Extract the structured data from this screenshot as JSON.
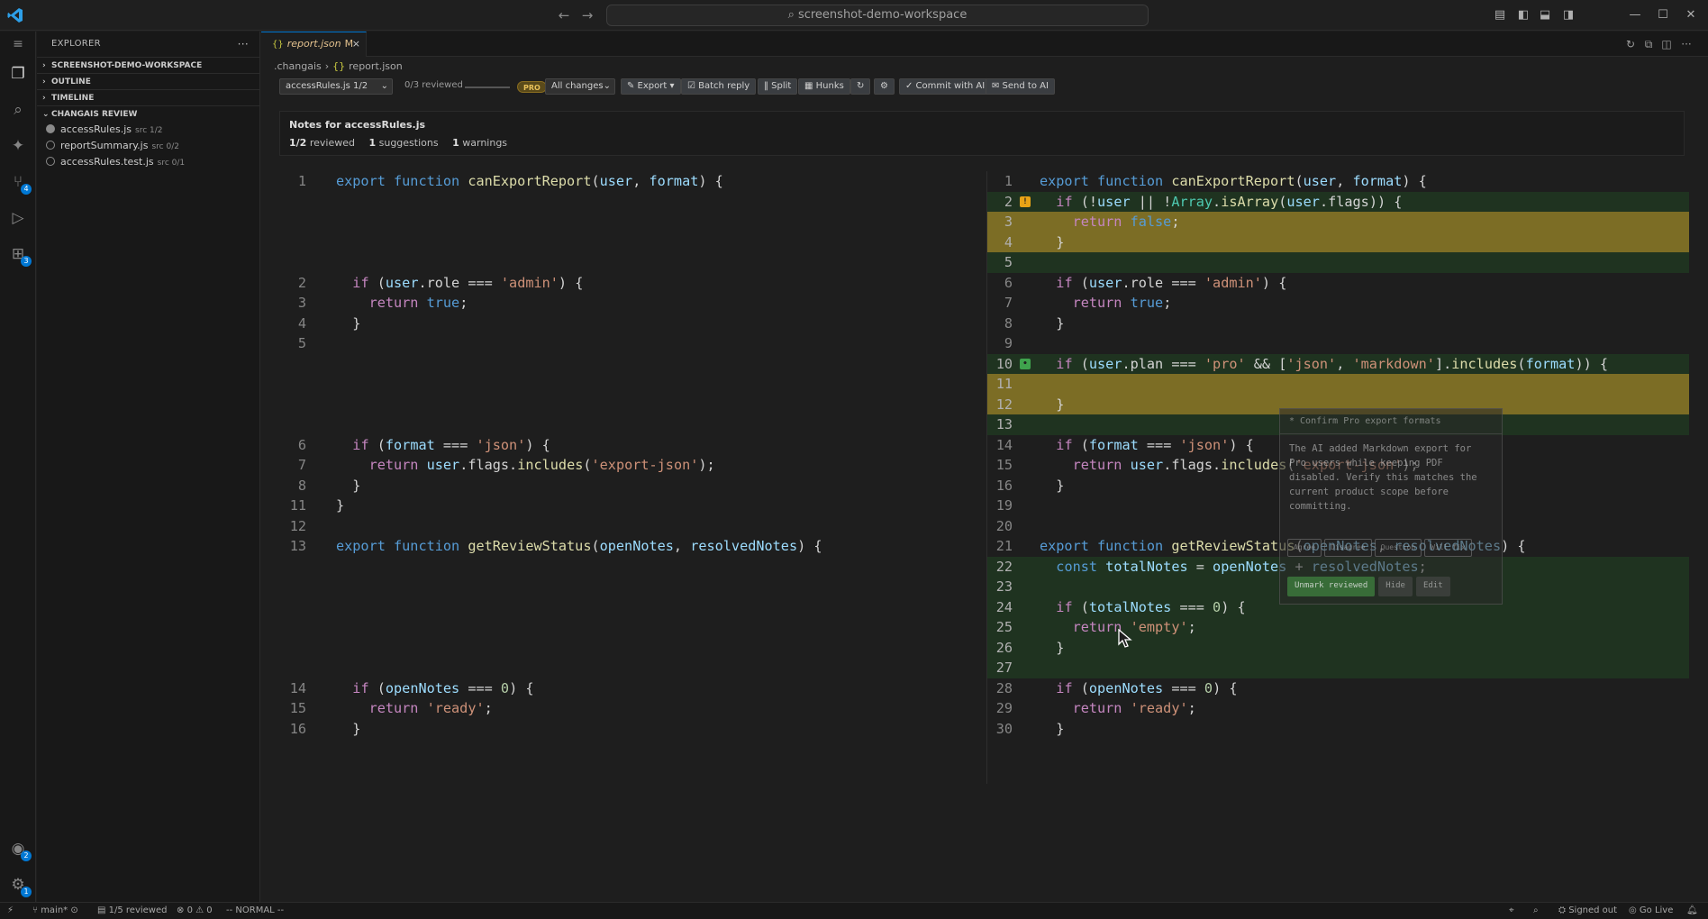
{
  "titlebar": {
    "search_text": "screenshot-demo-workspace",
    "back_icon": "arrow-left-icon",
    "forward_icon": "arrow-right-icon"
  },
  "activity": {
    "scm_badge": "4",
    "extensions_badge": "3",
    "accounts_badge": "2",
    "settings_badge": "1"
  },
  "sidebar": {
    "title": "EXPLORER",
    "sections": [
      "SCREENSHOT-DEMO-WORKSPACE",
      "OUTLINE",
      "TIMELINE",
      "CHANGAIS REVIEW"
    ],
    "files": [
      {
        "name": "accessRules.js",
        "meta": "src 1/2",
        "done": true
      },
      {
        "name": "reportSummary.js",
        "meta": "src 0/2",
        "done": false
      },
      {
        "name": "accessRules.test.js",
        "meta": "src 0/1",
        "done": false
      }
    ]
  },
  "editor": {
    "tab_label": "report.json",
    "tab_modified": "M",
    "breadcrumb": [
      ".changais",
      "report.json"
    ]
  },
  "toolbar": {
    "file_select": "accessRules.js 1/2",
    "reviewed": "0/3 reviewed",
    "reviewed_progress": 0,
    "pro_badge": "PRO",
    "changes_select": "All changes",
    "export": "✎ Export ▾",
    "batch_reply": "☑ Batch reply",
    "split": "‖ Split",
    "hunks": "▦ Hunks",
    "refresh": "↻",
    "settings": "⚙",
    "commit": "✓ Commit with AI",
    "send": "✉ Send to AI"
  },
  "notes": {
    "title": "Notes for accessRules.js",
    "reviewed_count": "1/2",
    "reviewed_label": "reviewed",
    "suggestions_count": "1",
    "suggestions_label": "suggestions",
    "warnings_count": "1",
    "warnings_label": "warnings"
  },
  "left_code": [
    {
      "n": "1",
      "row": 0,
      "ind": 0,
      "toks": [
        [
          "kw",
          "export "
        ],
        [
          "kw",
          "function "
        ],
        [
          "fn",
          "canExportReport"
        ],
        [
          "",
          "("
        ],
        [
          "pm",
          "user"
        ],
        [
          "",
          ", "
        ],
        [
          "pm",
          "format"
        ],
        [
          "",
          ") {"
        ]
      ]
    },
    {
      "n": "2",
      "row": 5,
      "ind": 1,
      "toks": [
        [
          "ctl",
          "if "
        ],
        [
          "",
          "("
        ],
        [
          "pm",
          "user"
        ],
        [
          "",
          ".role === "
        ],
        [
          "st2",
          "'admin'"
        ],
        [
          "",
          ") {"
        ]
      ]
    },
    {
      "n": "3",
      "row": 6,
      "ind": 2,
      "toks": [
        [
          "ctl",
          "return "
        ],
        [
          "kw",
          "true"
        ],
        [
          "",
          ";"
        ]
      ]
    },
    {
      "n": "4",
      "row": 7,
      "ind": 1,
      "toks": [
        [
          "",
          "}"
        ]
      ]
    },
    {
      "n": "5",
      "row": 8,
      "ind": 0,
      "toks": []
    },
    {
      "n": "6",
      "row": 13,
      "ind": 1,
      "toks": [
        [
          "ctl",
          "if "
        ],
        [
          "",
          "("
        ],
        [
          "pm",
          "format"
        ],
        [
          "",
          " === "
        ],
        [
          "st2",
          "'json'"
        ],
        [
          "",
          ") {"
        ]
      ]
    },
    {
      "n": "7",
      "row": 14,
      "ind": 2,
      "toks": [
        [
          "ctl",
          "return "
        ],
        [
          "pm",
          "user"
        ],
        [
          "",
          ".flags."
        ],
        [
          "fn",
          "includes"
        ],
        [
          "",
          "("
        ],
        [
          "st2",
          "'export-json'"
        ],
        [
          "",
          ");"
        ]
      ]
    },
    {
      "n": "8",
      "row": 15,
      "ind": 1,
      "toks": [
        [
          "",
          "}"
        ]
      ]
    },
    {
      "n": "11",
      "row": 16,
      "ind": 0,
      "toks": [
        [
          "",
          "}"
        ]
      ]
    },
    {
      "n": "12",
      "row": 17,
      "ind": 0,
      "toks": []
    },
    {
      "n": "13",
      "row": 18,
      "ind": 0,
      "toks": [
        [
          "kw",
          "export "
        ],
        [
          "kw",
          "function "
        ],
        [
          "fn",
          "getReviewStatus"
        ],
        [
          "",
          "("
        ],
        [
          "pm",
          "openNotes"
        ],
        [
          "",
          ", "
        ],
        [
          "pm",
          "resolvedNotes"
        ],
        [
          "",
          ") {"
        ]
      ]
    },
    {
      "n": "14",
      "row": 25,
      "ind": 1,
      "toks": [
        [
          "ctl",
          "if "
        ],
        [
          "",
          "("
        ],
        [
          "pm",
          "openNotes"
        ],
        [
          "",
          " === "
        ],
        [
          "num",
          "0"
        ],
        [
          "",
          ") {"
        ]
      ]
    },
    {
      "n": "15",
      "row": 26,
      "ind": 2,
      "toks": [
        [
          "ctl",
          "return "
        ],
        [
          "st2",
          "'ready'"
        ],
        [
          "",
          ";"
        ]
      ]
    },
    {
      "n": "16",
      "row": 27,
      "ind": 1,
      "toks": [
        [
          "",
          "}"
        ]
      ]
    }
  ],
  "right_code": [
    {
      "n": "1",
      "row": 0,
      "ind": 0,
      "bg": "",
      "toks": [
        [
          "kw",
          "export "
        ],
        [
          "kw",
          "function "
        ],
        [
          "fn",
          "canExportReport"
        ],
        [
          "",
          "("
        ],
        [
          "pm",
          "user"
        ],
        [
          "",
          ", "
        ],
        [
          "pm",
          "format"
        ],
        [
          "",
          ") {"
        ]
      ]
    },
    {
      "n": "2",
      "row": 1,
      "ind": 1,
      "bg": "add",
      "mark": "warn",
      "toks": [
        [
          "ctl",
          "if "
        ],
        [
          "",
          "(!"
        ],
        [
          "pm",
          "user"
        ],
        [
          "",
          " || !"
        ],
        [
          "ty",
          "Array"
        ],
        [
          "",
          "."
        ],
        [
          "fn",
          "isArray"
        ],
        [
          "",
          "("
        ],
        [
          "pm",
          "user"
        ],
        [
          "",
          ".flags)) {"
        ]
      ]
    },
    {
      "n": "3",
      "row": 2,
      "ind": 2,
      "bg": "hl",
      "toks": [
        [
          "ctl",
          "return "
        ],
        [
          "kw",
          "false"
        ],
        [
          "",
          ";"
        ]
      ]
    },
    {
      "n": "4",
      "row": 3,
      "ind": 1,
      "bg": "hl",
      "toks": [
        [
          "",
          "}"
        ]
      ]
    },
    {
      "n": "5",
      "row": 4,
      "ind": 0,
      "bg": "add",
      "toks": []
    },
    {
      "n": "6",
      "row": 5,
      "ind": 1,
      "bg": "",
      "toks": [
        [
          "ctl",
          "if "
        ],
        [
          "",
          "("
        ],
        [
          "pm",
          "user"
        ],
        [
          "",
          ".role === "
        ],
        [
          "st2",
          "'admin'"
        ],
        [
          "",
          ") {"
        ]
      ]
    },
    {
      "n": "7",
      "row": 6,
      "ind": 2,
      "bg": "",
      "toks": [
        [
          "ctl",
          "return "
        ],
        [
          "kw",
          "true"
        ],
        [
          "",
          ";"
        ]
      ]
    },
    {
      "n": "8",
      "row": 7,
      "ind": 1,
      "bg": "",
      "toks": [
        [
          "",
          "}"
        ]
      ]
    },
    {
      "n": "9",
      "row": 8,
      "ind": 0,
      "bg": "",
      "toks": []
    },
    {
      "n": "10",
      "row": 9,
      "ind": 1,
      "bg": "add",
      "mark": "ok",
      "toks": [
        [
          "ctl",
          "if "
        ],
        [
          "",
          "("
        ],
        [
          "pm",
          "user"
        ],
        [
          "",
          ".plan === "
        ],
        [
          "st2",
          "'pro'"
        ],
        [
          "",
          " && ["
        ],
        [
          "st2",
          "'json'"
        ],
        [
          "",
          ", "
        ],
        [
          "st2",
          "'markdown'"
        ],
        [
          "",
          "]."
        ],
        [
          "fn",
          "includes"
        ],
        [
          "",
          "("
        ],
        [
          "pm",
          "format"
        ],
        [
          "",
          ")) {"
        ]
      ]
    },
    {
      "n": "11",
      "row": 10,
      "ind": 2,
      "bg": "hl",
      "toks": []
    },
    {
      "n": "12",
      "row": 11,
      "ind": 1,
      "bg": "hl",
      "toks": [
        [
          "",
          "}"
        ]
      ]
    },
    {
      "n": "13",
      "row": 12,
      "ind": 0,
      "bg": "add",
      "toks": []
    },
    {
      "n": "14",
      "row": 13,
      "ind": 1,
      "bg": "",
      "toks": [
        [
          "ctl",
          "if "
        ],
        [
          "",
          "("
        ],
        [
          "pm",
          "format"
        ],
        [
          "",
          " === "
        ],
        [
          "st2",
          "'json'"
        ],
        [
          "",
          ") {"
        ]
      ]
    },
    {
      "n": "15",
      "row": 14,
      "ind": 2,
      "bg": "",
      "toks": [
        [
          "ctl",
          "return "
        ],
        [
          "pm",
          "user"
        ],
        [
          "",
          ".flags."
        ],
        [
          "fn",
          "includes"
        ],
        [
          "",
          "("
        ],
        [
          "st2",
          "'export-json'"
        ],
        [
          "",
          ");"
        ]
      ]
    },
    {
      "n": "16",
      "row": 15,
      "ind": 1,
      "bg": "",
      "toks": [
        [
          "",
          "}"
        ]
      ]
    },
    {
      "n": "19",
      "row": 16,
      "ind": 0,
      "bg": "",
      "toks": []
    },
    {
      "n": "20",
      "row": 17,
      "ind": 0,
      "bg": "",
      "toks": []
    },
    {
      "n": "21",
      "row": 18,
      "ind": 0,
      "bg": "",
      "toks": [
        [
          "kw",
          "export "
        ],
        [
          "kw",
          "function "
        ],
        [
          "fn",
          "getReviewStatus"
        ],
        [
          "",
          "("
        ],
        [
          "pm",
          "openNotes"
        ],
        [
          "",
          ", "
        ],
        [
          "pm",
          "resolvedNotes"
        ],
        [
          "",
          ") {"
        ]
      ]
    },
    {
      "n": "22",
      "row": 19,
      "ind": 1,
      "bg": "add",
      "toks": [
        [
          "kw",
          "const "
        ],
        [
          "pm",
          "totalNotes"
        ],
        [
          "",
          " = "
        ],
        [
          "pm",
          "openNotes"
        ],
        [
          "",
          " + "
        ],
        [
          "pm",
          "resolvedNotes"
        ],
        [
          "",
          ";"
        ]
      ]
    },
    {
      "n": "23",
      "row": 20,
      "ind": 0,
      "bg": "add",
      "toks": []
    },
    {
      "n": "24",
      "row": 21,
      "ind": 1,
      "bg": "add",
      "toks": [
        [
          "ctl",
          "if "
        ],
        [
          "",
          "("
        ],
        [
          "pm",
          "totalNotes"
        ],
        [
          "",
          " === "
        ],
        [
          "num",
          "0"
        ],
        [
          "",
          ") {"
        ]
      ]
    },
    {
      "n": "25",
      "row": 22,
      "ind": 2,
      "bg": "add",
      "toks": [
        [
          "ctl",
          "return "
        ],
        [
          "st2",
          "'empty'"
        ],
        [
          "",
          ";"
        ]
      ]
    },
    {
      "n": "26",
      "row": 23,
      "ind": 1,
      "bg": "add",
      "toks": [
        [
          "",
          "}"
        ]
      ]
    },
    {
      "n": "27",
      "row": 24,
      "ind": 0,
      "bg": "add",
      "toks": []
    },
    {
      "n": "28",
      "row": 25,
      "ind": 1,
      "bg": "",
      "toks": [
        [
          "ctl",
          "if "
        ],
        [
          "",
          "("
        ],
        [
          "pm",
          "openNotes"
        ],
        [
          "",
          " === "
        ],
        [
          "num",
          "0"
        ],
        [
          "",
          ") {"
        ]
      ]
    },
    {
      "n": "29",
      "row": 26,
      "ind": 2,
      "bg": "",
      "toks": [
        [
          "ctl",
          "return "
        ],
        [
          "st2",
          "'ready'"
        ],
        [
          "",
          ";"
        ]
      ]
    },
    {
      "n": "30",
      "row": 27,
      "ind": 1,
      "bg": "",
      "toks": [
        [
          "",
          "}"
        ]
      ]
    }
  ],
  "hovercard": {
    "header": "* Confirm Pro export formats",
    "body": "The AI added Markdown export for Pro users while keeping PDF disabled. Verify this matches the current product scope before committing.",
    "replies": [
      "Agree",
      "Disagree",
      "Question",
      "Will fix"
    ],
    "unmark": "Unmark reviewed",
    "hide": "Hide",
    "edit": "Edit"
  },
  "statusbar": {
    "branch": "main*",
    "reviewed": "1/5 reviewed",
    "problems": "0 ⚠ 0",
    "mode": "-- NORMAL --",
    "signed_out": "Signed out",
    "go_live": "Go Live"
  },
  "colors": {
    "accent": "#0078d4",
    "added_bg": "#1f3320",
    "highlight_bg": "#7c6d25",
    "warn_marker": "#e8a316",
    "ok_marker": "#3fa34d"
  }
}
